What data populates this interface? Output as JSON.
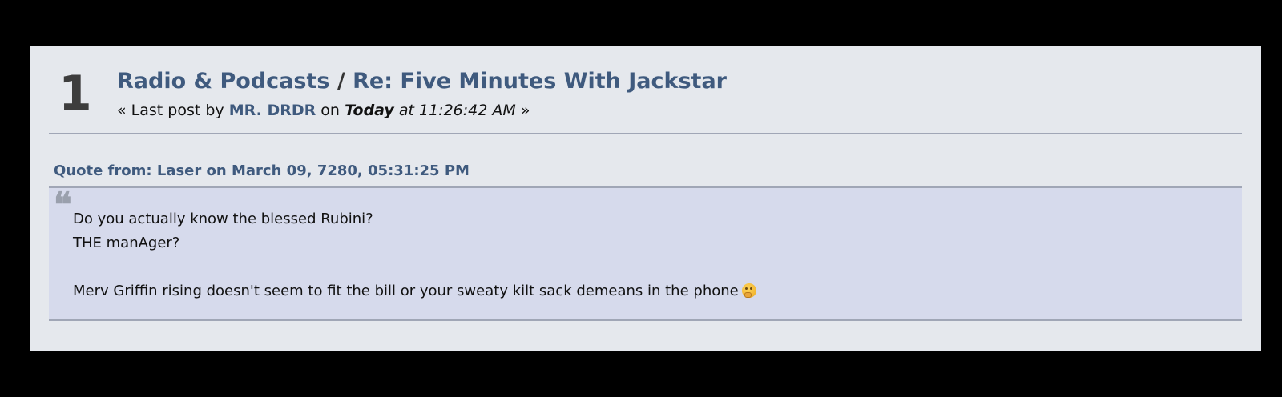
{
  "post": {
    "number": "1",
    "board": "Radio & Podcasts",
    "separator": "/",
    "topic": "Re: Five Minutes With Jackstar",
    "meta_prefix": "« Last post by",
    "author": "MR. DRDR",
    "meta_on": "on",
    "meta_today": "Today",
    "meta_time": "at 11:26:42 AM",
    "meta_suffix": "»"
  },
  "quote": {
    "header": "Quote from: Laser on March 09, 7280, 05:31:25 PM",
    "mark": "❝",
    "lines": [
      "Do you actually know the blessed Rubini?",
      "THE manAger?",
      "",
      "Merv Griffin rising doesn't seem to fit the bill or your sweaty kilt sack demeans in the phone"
    ],
    "emoji": "thinking-face-icon"
  },
  "colors": {
    "page_bg": "#000000",
    "panel_bg": "#e5e8ed",
    "quote_bg": "#d6daec",
    "link": "#3f5a7e",
    "divider": "#a0a6b6"
  }
}
